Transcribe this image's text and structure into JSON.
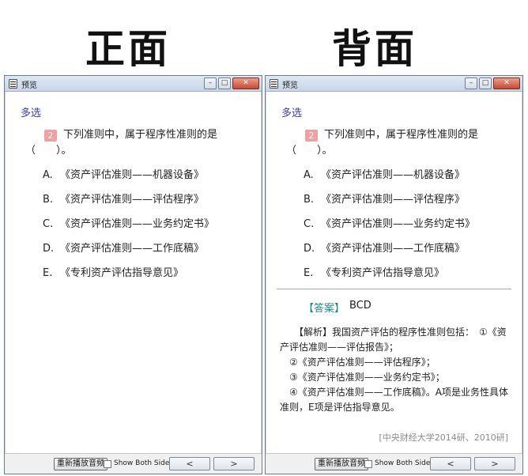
{
  "headings": {
    "front": "正面",
    "back": "背面"
  },
  "window": {
    "title": "预览",
    "minimize": "–",
    "maximize": "□",
    "close": "✕"
  },
  "question": {
    "type": "多选",
    "number": "2",
    "text_line1": "下列准则中，属于程序性准则的是",
    "text_line2": "（　　）。",
    "options": [
      {
        "letter": "A.",
        "text": "《资产评估准则——机器设备》"
      },
      {
        "letter": "B.",
        "text": "《资产评估准则——评估程序》"
      },
      {
        "letter": "C.",
        "text": "《资产评估准则——业务约定书》"
      },
      {
        "letter": "D.",
        "text": "《资产评估准则——工作底稿》"
      },
      {
        "letter": "E.",
        "text": "《专利资产评估指导意见》"
      }
    ]
  },
  "answer": {
    "label": "【答案】",
    "value": "BCD",
    "analysis_lines": [
      "　　【解析】我国资产评估的程序性准则包括：　①《资产评估准则——评估报告》；",
      "　②《资产评估准则——评估程序》；",
      "　③《资产评估准则——业务约定书》；",
      "　④《资产评估准则——工作底稿》。A项是业务性具体准则，E项是评估指导意见。"
    ],
    "source": "[中央财经大学2014研、2010研]"
  },
  "bottombar": {
    "replay_label": "重新播放音频",
    "show_both_label": "Show Both Sides",
    "show_both_checked": false,
    "prev_label": "<",
    "next_label": ">"
  }
}
